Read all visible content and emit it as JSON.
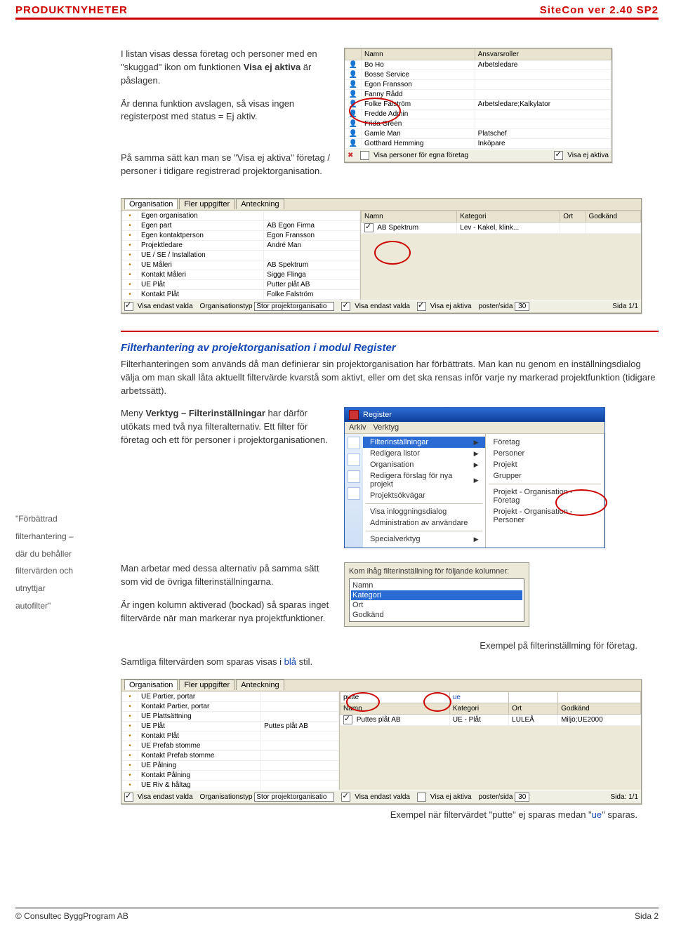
{
  "header": {
    "left": "PRODUKTNYHETER",
    "right": "SiteCon ver 2.40 SP2"
  },
  "section1": {
    "p1_pre": "I listan visas dessa företag och personer med en \"skuggad\" ikon om funktionen ",
    "p1_bold": "Visa ej aktiva",
    "p1_post": " är påslagen.",
    "p2": "Är denna funktion avslagen, så visas ingen registerpost med status = Ej aktiv.",
    "p3": "På samma sätt kan man se \"Visa ej aktiva\" företag / personer i tidigare registrerad projektorganisation."
  },
  "shot_persons": {
    "columns": [
      "Namn",
      "Ansvarsroller"
    ],
    "rows": [
      [
        "Bo Ho",
        "Arbetsledare"
      ],
      [
        "Bosse Service",
        ""
      ],
      [
        "Egon Fransson",
        ""
      ],
      [
        "Fanny Rådd",
        ""
      ],
      [
        "Folke Falström",
        "Arbetsledare;Kalkylator"
      ],
      [
        "Fredde Admin",
        ""
      ],
      [
        "Frida Green",
        ""
      ],
      [
        "Gamle Man",
        "Platschef"
      ],
      [
        "Gotthard Hemming",
        "Inköpare"
      ]
    ],
    "footer_left": "Visa personer för egna företag",
    "footer_right": "Visa ej aktiva"
  },
  "shot_org": {
    "tabs": [
      "Organisation",
      "Fler uppgifter",
      "Anteckning"
    ],
    "left_rows": [
      [
        "Egen organisation",
        ""
      ],
      [
        "Egen part",
        "AB Egon Firma"
      ],
      [
        "Egen kontaktperson",
        "Egon Fransson"
      ],
      [
        "Projektledare",
        "André Man"
      ],
      [
        "UE / SE / Installation",
        ""
      ],
      [
        "UE Måleri",
        "AB Spektrum"
      ],
      [
        "Kontakt Måleri",
        "Sigge Flinga"
      ],
      [
        "UE Plåt",
        "Putter plåt AB"
      ],
      [
        "Kontakt Plåt",
        "Folke Falström"
      ]
    ],
    "right_cols": [
      "Namn",
      "Kategori",
      "Ort",
      "Godkänd"
    ],
    "right_row": [
      "AB Spektrum",
      "Lev - Kakel, klink...",
      "",
      ""
    ],
    "footer": {
      "visa_endast": "Visa endast valda",
      "orgtyp_lbl": "Organisationstyp",
      "orgtyp_val": "Stor projektorganisatio",
      "visa_ej": "Visa ej aktiva",
      "poster_lbl": "poster/sida",
      "poster_val": "30",
      "sida": "Sida  1/1"
    }
  },
  "section2": {
    "heading": "Filterhantering av projektorganisation i modul Register",
    "p1": "Filterhanteringen som används då man definierar sin projektorganisation har förbättrats. Man kan nu genom en inställningsdialog välja om man skall låta aktuellt filtervärde kvarstå som aktivt, eller om det ska rensas inför varje ny markerad projektfunktion (tidigare arbetssätt).",
    "p2_pre": "Meny ",
    "p2_bold": "Verktyg – Filterinställningar",
    "p2_post": " har därför utökats med två nya filteralternativ. Ett filter för företag och ett för personer i projektorganisationen.",
    "p3": "Man arbetar med dessa alternativ på samma sätt som vid de övriga filterinställningarna.",
    "p4": "Är ingen kolumn aktiverad (bockad) så sparas inget filtervärde när man markerar nya projektfunktioner.",
    "p5_pre": "Samtliga filtervärden som sparas visas i ",
    "p5_blue": "blå",
    "p5_post": " stil.",
    "cap1": "Exempel på filterinställming för företag.",
    "cap2_pre": "Exempel när filtervärdet \"putte\" ej sparas medan \"",
    "cap2_blue": "ue",
    "cap2_post": "\" sparas."
  },
  "sidenote": {
    "l1": "\"Förbättrad",
    "l2": "filterhantering –",
    "l3": "där du behåller",
    "l4": "filtervärden och",
    "l5": "utnyttjar",
    "l6": "autofilter\""
  },
  "menuwin": {
    "title": "Register",
    "menubar": [
      "Arkiv",
      "Verktyg"
    ],
    "col1": [
      {
        "label": "Filterinställningar",
        "sel": true,
        "arrow": true
      },
      {
        "label": "Redigera listor",
        "arrow": true
      },
      {
        "label": "Organisation",
        "arrow": true
      },
      {
        "label": "Redigera förslag för nya projekt",
        "arrow": true
      },
      {
        "label": "Projektsökvägar"
      },
      {
        "sep": true
      },
      {
        "label": "Visa inloggningsdialog"
      },
      {
        "label": "Administration av användare"
      },
      {
        "sep": true
      },
      {
        "label": "Specialverktyg",
        "arrow": true
      }
    ],
    "col2": [
      {
        "label": "Företag"
      },
      {
        "label": "Personer"
      },
      {
        "label": "Projekt"
      },
      {
        "label": "Grupper"
      },
      {
        "sep": true
      },
      {
        "label": "Projekt - Organisation - Företag"
      },
      {
        "label": "Projekt - Organisation - Personer"
      }
    ]
  },
  "filterbox": {
    "label": "Kom ihåg filterinställning för följande kolumner:",
    "items": [
      {
        "label": "Namn",
        "on": false
      },
      {
        "label": "Kategori",
        "on": true,
        "sel": true
      },
      {
        "label": "Ort",
        "on": false
      },
      {
        "label": "Godkänd",
        "on": false
      }
    ]
  },
  "shot_org2": {
    "tabs": [
      "Organisation",
      "Fler uppgifter",
      "Anteckning"
    ],
    "left_rows": [
      [
        "UE Partier, portar",
        ""
      ],
      [
        "Kontakt Partier, portar",
        ""
      ],
      [
        "UE Plattsättning",
        ""
      ],
      [
        "UE Plåt",
        "Puttes plåt AB"
      ],
      [
        "Kontakt Plåt",
        ""
      ],
      [
        "UE Prefab stomme",
        ""
      ],
      [
        "Kontakt Prefab stomme",
        ""
      ],
      [
        "UE Pålning",
        ""
      ],
      [
        "Kontakt Pålning",
        ""
      ],
      [
        "UE Riv & håltag",
        ""
      ]
    ],
    "filter_vals": [
      "putte",
      "ue",
      "",
      ""
    ],
    "right_cols": [
      "Namn",
      "Kategori",
      "Ort",
      "Godkänd"
    ],
    "right_row": [
      "Puttes plåt AB",
      "UE - Plåt",
      "LULEÅ",
      "Miljö;UE2000"
    ],
    "footer": {
      "visa_endast": "Visa endast valda",
      "orgtyp_lbl": "Organisationstyp",
      "orgtyp_val": "Stor projektorganisatio",
      "visa_ej": "Visa ej aktiva",
      "poster_lbl": "poster/sida",
      "poster_val": "30",
      "sida": "Sida:  1/1"
    }
  },
  "footer": {
    "left": "© Consultec ByggProgram AB",
    "right": "Sida 2"
  }
}
